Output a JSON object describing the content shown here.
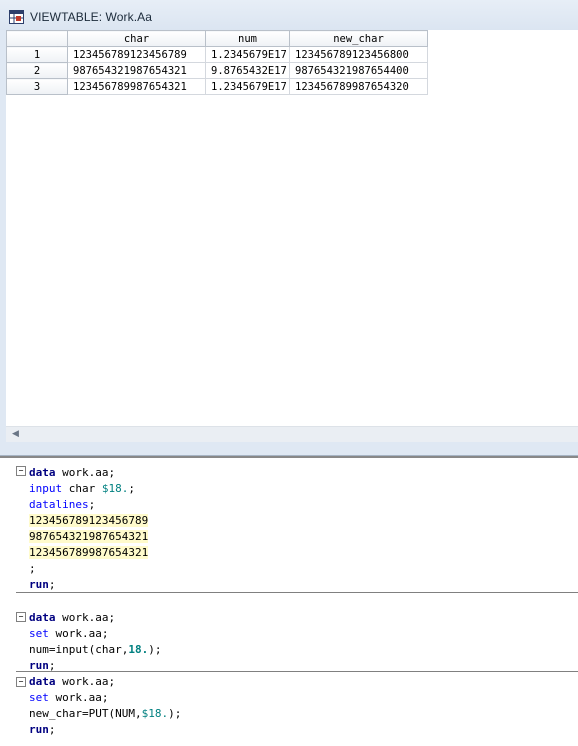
{
  "window": {
    "title": "VIEWTABLE: Work.Aa"
  },
  "table": {
    "columns": [
      "char",
      "num",
      "new_char"
    ],
    "rows": [
      {
        "n": "1",
        "char": "123456789123456789",
        "num": "1.2345679E17",
        "new_char": "123456789123456800"
      },
      {
        "n": "2",
        "char": "987654321987654321",
        "num": "9.8765432E17",
        "new_char": "987654321987654400"
      },
      {
        "n": "3",
        "char": "123456789987654321",
        "num": "1.2345679E17",
        "new_char": "123456789987654320"
      }
    ]
  },
  "code": {
    "block1": {
      "data_kw": "data",
      "dataset1": " work.aa;",
      "input_kw": "input",
      "input_var": " char ",
      "input_fmt": "$18.",
      "input_end": ";",
      "datalines_kw": "datalines",
      "datalines_end": ";",
      "lines": [
        "123456789123456789",
        "987654321987654321",
        "123456789987654321"
      ],
      "terminator": ";",
      "run_kw": "run",
      "run_end": ";"
    },
    "block2": {
      "data_kw": "data",
      "dataset": " work.aa;",
      "set_kw": "set",
      "set_ds": " work.aa;",
      "assign_pre": "num=input(char,",
      "assign_fmt": "18.",
      "assign_end": ");",
      "run_kw": "run",
      "run_end": ";"
    },
    "block3": {
      "data_kw": "data",
      "dataset": " work.aa;",
      "set_kw": "set",
      "set_ds": " work.aa;",
      "assign_pre": "new_char=PUT(NUM,",
      "assign_fmt": "$18.",
      "assign_end": ");",
      "run_kw": "run",
      "run_end": ";"
    },
    "fold_symbol": "−"
  },
  "colors": {
    "keyword": "#000080",
    "format": "#008080",
    "datalines_highlight": "#fffbcc",
    "titlebar": "#dfe8f3"
  }
}
